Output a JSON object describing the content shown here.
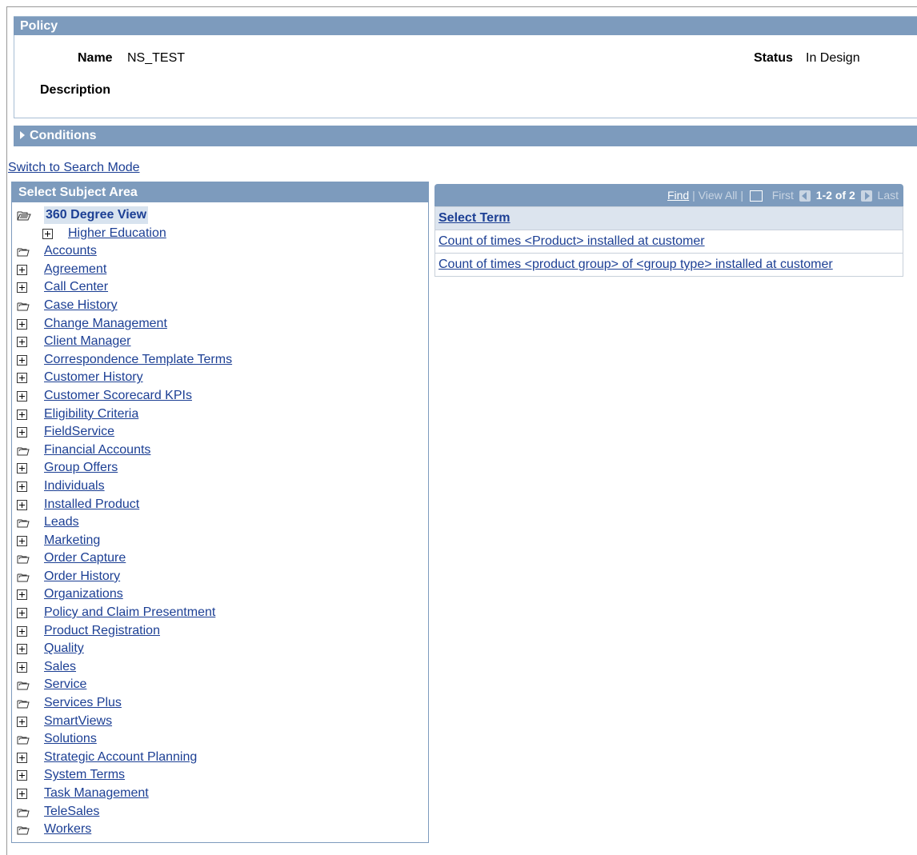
{
  "policy": {
    "header": "Policy",
    "name_label": "Name",
    "name_value": "NS_TEST",
    "status_label": "Status",
    "status_value": "In Design",
    "description_label": "Description"
  },
  "conditions": {
    "header": "Conditions"
  },
  "switch_mode": "Switch to Search Mode",
  "subject_area": {
    "header": "Select Subject Area",
    "items": [
      {
        "label": "360 Degree View",
        "icon": "folder-open-icon",
        "selected": true
      },
      {
        "label": "Higher Education",
        "icon": "expand-plus-icon",
        "child": true
      },
      {
        "label": "Accounts",
        "icon": "folder-icon"
      },
      {
        "label": "Agreement",
        "icon": "expand-plus-icon"
      },
      {
        "label": "Call Center",
        "icon": "expand-plus-icon"
      },
      {
        "label": "Case History",
        "icon": "folder-icon"
      },
      {
        "label": "Change Management",
        "icon": "expand-plus-icon"
      },
      {
        "label": "Client Manager",
        "icon": "expand-plus-icon"
      },
      {
        "label": "Correspondence Template Terms",
        "icon": "expand-plus-icon"
      },
      {
        "label": "Customer History",
        "icon": "expand-plus-icon"
      },
      {
        "label": "Customer Scorecard KPIs",
        "icon": "expand-plus-icon"
      },
      {
        "label": "Eligibility Criteria",
        "icon": "expand-plus-icon"
      },
      {
        "label": "FieldService",
        "icon": "expand-plus-icon"
      },
      {
        "label": "Financial Accounts",
        "icon": "folder-icon"
      },
      {
        "label": "Group Offers",
        "icon": "expand-plus-icon"
      },
      {
        "label": "Individuals",
        "icon": "expand-plus-icon"
      },
      {
        "label": "Installed Product",
        "icon": "expand-plus-icon"
      },
      {
        "label": "Leads",
        "icon": "folder-icon"
      },
      {
        "label": "Marketing",
        "icon": "expand-plus-icon"
      },
      {
        "label": "Order Capture",
        "icon": "folder-icon"
      },
      {
        "label": "Order History",
        "icon": "folder-icon"
      },
      {
        "label": "Organizations",
        "icon": "expand-plus-icon"
      },
      {
        "label": "Policy and Claim Presentment",
        "icon": "expand-plus-icon"
      },
      {
        "label": "Product Registration",
        "icon": "expand-plus-icon"
      },
      {
        "label": "Quality",
        "icon": "expand-plus-icon"
      },
      {
        "label": "Sales",
        "icon": "expand-plus-icon"
      },
      {
        "label": "Service",
        "icon": "folder-icon"
      },
      {
        "label": "Services Plus",
        "icon": "folder-icon"
      },
      {
        "label": "SmartViews",
        "icon": "expand-plus-icon"
      },
      {
        "label": "Solutions",
        "icon": "folder-icon"
      },
      {
        "label": "Strategic Account Planning",
        "icon": "expand-plus-icon"
      },
      {
        "label": "System Terms",
        "icon": "expand-plus-icon"
      },
      {
        "label": "Task Management",
        "icon": "expand-plus-icon"
      },
      {
        "label": "TeleSales",
        "icon": "folder-icon"
      },
      {
        "label": "Workers",
        "icon": "folder-icon"
      }
    ]
  },
  "terms_grid": {
    "find": "Find",
    "view_all": "View All",
    "first": "First",
    "count": "1-2 of 2",
    "last": "Last",
    "column_header": "Select Term",
    "rows": [
      "Count of times <Product> installed at customer",
      "Count of times <product group> of <group type> installed at customer"
    ]
  }
}
